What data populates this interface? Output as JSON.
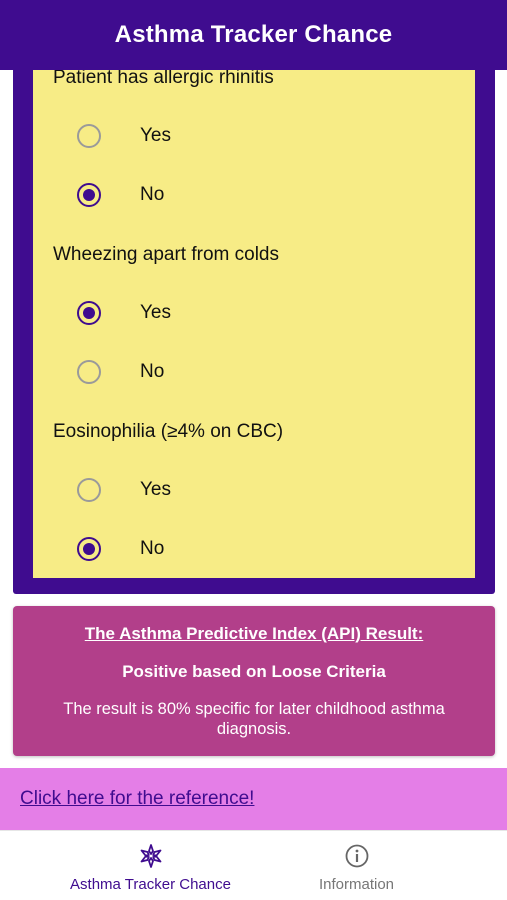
{
  "header": {
    "title": "Asthma Tracker Chance"
  },
  "questions": [
    {
      "label": "Patient has allergic rhinitis",
      "options": [
        {
          "label": "Yes",
          "selected": false
        },
        {
          "label": "No",
          "selected": true
        }
      ]
    },
    {
      "label": "Wheezing apart from colds",
      "options": [
        {
          "label": "Yes",
          "selected": true
        },
        {
          "label": "No",
          "selected": false
        }
      ]
    },
    {
      "label": "Eosinophilia (≥4% on CBC)",
      "options": [
        {
          "label": "Yes",
          "selected": false
        },
        {
          "label": "No",
          "selected": true
        }
      ]
    }
  ],
  "result": {
    "title": "The Asthma Predictive Index (API) Result:",
    "status": "Positive based on Loose Criteria",
    "description": "The result is 80% specific for later childhood asthma diagnosis."
  },
  "reference": {
    "link_text": "Click here for the reference!"
  },
  "tabs": [
    {
      "label": "Asthma Tracker Chance",
      "icon": "asterisk-flower-icon",
      "active": true
    },
    {
      "label": "Information",
      "icon": "info-circle-icon",
      "active": false
    }
  ],
  "colors": {
    "header": "#3f0c8f",
    "card": "#f7ec86",
    "result": "#b23f8a",
    "reference_bar": "#e47ee7"
  }
}
